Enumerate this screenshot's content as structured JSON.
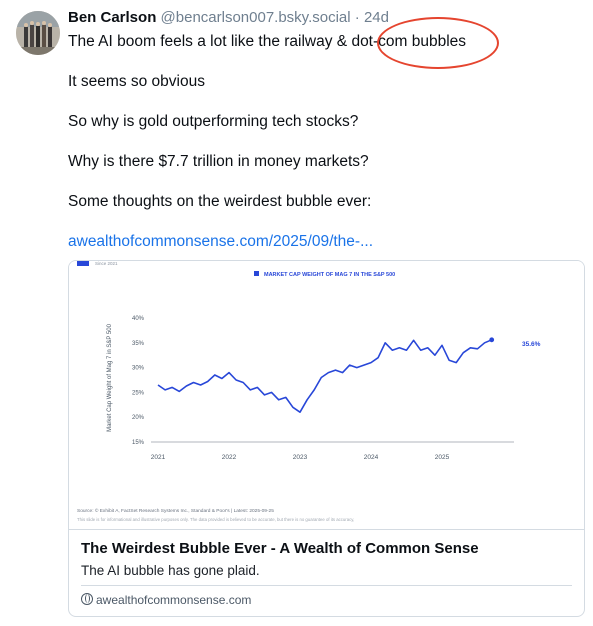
{
  "post": {
    "author": "Ben Carlson",
    "handle": "@bencarlson007.bsky.social",
    "separator": "·",
    "time": "24d",
    "lines": [
      "The AI boom feels a lot like the railway & dot-com bubbles",
      "It seems so obvious",
      "So why is gold outperforming tech stocks?",
      "Why is there $7.7 trillion in money markets?",
      "Some thoughts on the weirdest bubble ever:"
    ],
    "link": "awealthofcommonsense.com/2025/09/the-..."
  },
  "annotation": {
    "circle_color": "#e5452f"
  },
  "card": {
    "title": "The Weirdest Bubble Ever - A Wealth of Common Sense",
    "description": "The AI bubble has gone plaid.",
    "domain": "awealthofcommonsense.com"
  },
  "chart_data": {
    "type": "line",
    "title": "MARKET CAP WEIGHT OF MAG 7 IN THE S&P 500",
    "top_legend": "Since 2021",
    "ylabel": "Market Cap Weight of Mag 7 in S&P 500",
    "xlabel": "",
    "ylim": [
      15,
      40
    ],
    "yticks": [
      "40%",
      "35%",
      "30%",
      "25%",
      "20%",
      "15%"
    ],
    "xticks": [
      "2021",
      "2022",
      "2023",
      "2024",
      "2025"
    ],
    "end_label": "35.6%",
    "series": [
      {
        "name": "MARKET CAP WEIGHT OF MAG 7 IN THE S&P 500",
        "color": "#2847d8",
        "x": [
          2021.0,
          2021.1,
          2021.2,
          2021.3,
          2021.4,
          2021.5,
          2021.6,
          2021.7,
          2021.8,
          2021.9,
          2022.0,
          2022.1,
          2022.2,
          2022.3,
          2022.4,
          2022.5,
          2022.6,
          2022.7,
          2022.8,
          2022.9,
          2023.0,
          2023.1,
          2023.2,
          2023.3,
          2023.4,
          2023.5,
          2023.6,
          2023.7,
          2023.8,
          2023.9,
          2024.0,
          2024.1,
          2024.2,
          2024.3,
          2024.4,
          2024.5,
          2024.6,
          2024.7,
          2024.8,
          2024.9,
          2025.0,
          2025.1,
          2025.2,
          2025.3,
          2025.4,
          2025.5,
          2025.6,
          2025.7
        ],
        "y": [
          26.5,
          25.5,
          26.0,
          25.2,
          26.3,
          27.0,
          26.5,
          27.2,
          28.5,
          27.8,
          29.0,
          27.5,
          27.0,
          25.5,
          26.0,
          24.5,
          25.0,
          23.5,
          24.0,
          22.0,
          21.0,
          23.5,
          25.5,
          28.0,
          29.0,
          29.5,
          29.0,
          30.5,
          30.0,
          30.5,
          31.0,
          32.0,
          35.0,
          33.5,
          34.0,
          33.5,
          35.5,
          33.5,
          34.0,
          32.5,
          34.5,
          31.5,
          31.0,
          33.0,
          34.0,
          33.8,
          35.0,
          35.6
        ]
      }
    ],
    "source_line": "Source: © Exhibit A, FactSet Research Systems Inc., Standard & Poor's | Latest: 2025-09-25",
    "disclaimer_line": "This slide is for informational and illustrative purposes only. The data provided is believed to be accurate, but there is no guarantee of its accuracy,"
  }
}
